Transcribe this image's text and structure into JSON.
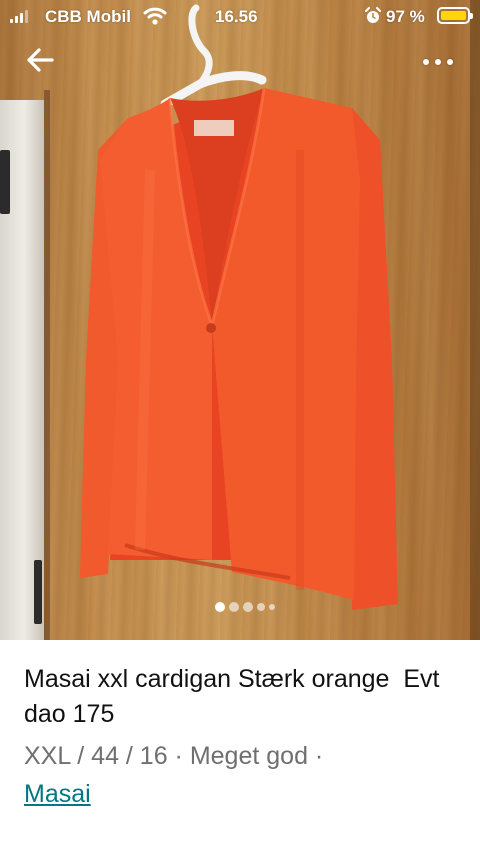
{
  "status_bar": {
    "carrier": "CBB Mobil",
    "time": "16.56",
    "battery_percent": "97 %",
    "battery_color": "#ffd60a"
  },
  "listing": {
    "title": "Masai xxl cardigan Stærk orange  Evt dao 175",
    "details": "XXL / 44 / 16 · Meget god ·",
    "brand": "Masai"
  },
  "gallery": {
    "current_image": 1,
    "image_count": 5
  },
  "icons": {
    "back": "arrow-left-icon",
    "more": "more-horizontal-icon",
    "wifi": "wifi-icon",
    "alarm": "alarm-icon",
    "signal": "signal-icon",
    "battery": "battery-icon"
  },
  "colors": {
    "garment": "#f0502a",
    "brand_link": "#007782"
  }
}
